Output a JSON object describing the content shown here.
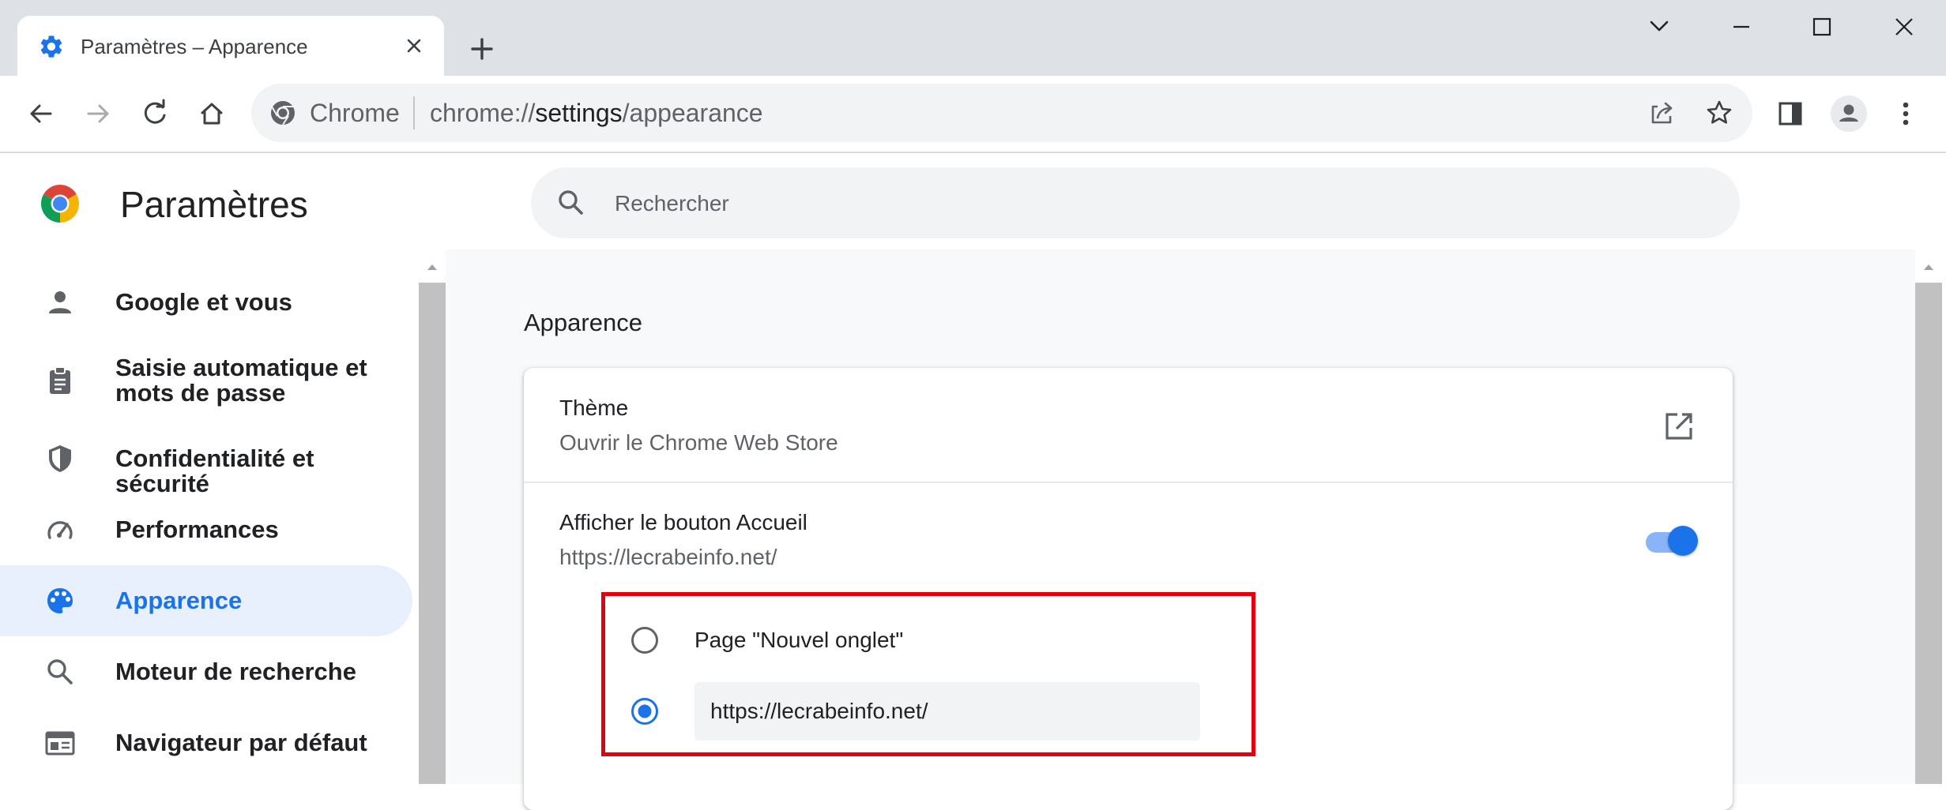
{
  "window": {
    "tab_title": "Paramètres – Apparence",
    "tab_icon": "settings-gear-icon",
    "controls": [
      "minimize-icon",
      "maximize-icon",
      "close-icon"
    ]
  },
  "toolbar": {
    "omnibox_chip": "Chrome",
    "url_scheme": "chrome://",
    "url_host": "settings",
    "url_path": "/appearance"
  },
  "header": {
    "title": "Paramètres",
    "search_placeholder": "Rechercher"
  },
  "sidebar": {
    "items": [
      {
        "label": "Google et vous",
        "icon": "person-icon",
        "active": false
      },
      {
        "label": "Saisie automatique et mots de passe",
        "icon": "clipboard-icon",
        "active": false
      },
      {
        "label": "Confidentialité et sécurité",
        "icon": "shield-icon",
        "active": false
      },
      {
        "label": "Performances",
        "icon": "speedometer-icon",
        "active": false
      },
      {
        "label": "Apparence",
        "icon": "palette-icon",
        "active": true
      },
      {
        "label": "Moteur de recherche",
        "icon": "search-icon",
        "active": false
      },
      {
        "label": "Navigateur par défaut",
        "icon": "browser-window-icon",
        "active": false
      }
    ]
  },
  "main": {
    "section_title": "Apparence",
    "theme": {
      "title": "Thème",
      "subtitle": "Ouvrir le Chrome Web Store"
    },
    "home_button": {
      "title": "Afficher le bouton Accueil",
      "subtitle": "https://lecrabeinfo.net/",
      "enabled": true,
      "options": [
        {
          "label": "Page \"Nouvel onglet\"",
          "selected": false
        },
        {
          "label": "https://lecrabeinfo.net/",
          "selected": true
        }
      ],
      "custom_url_value": "https://lecrabeinfo.net/"
    }
  },
  "colors": {
    "accent": "#1a73e8",
    "active_nav_bg": "#e8f0fe",
    "highlight_border": "#e0000f",
    "titlebar_bg": "#dee1e6"
  }
}
